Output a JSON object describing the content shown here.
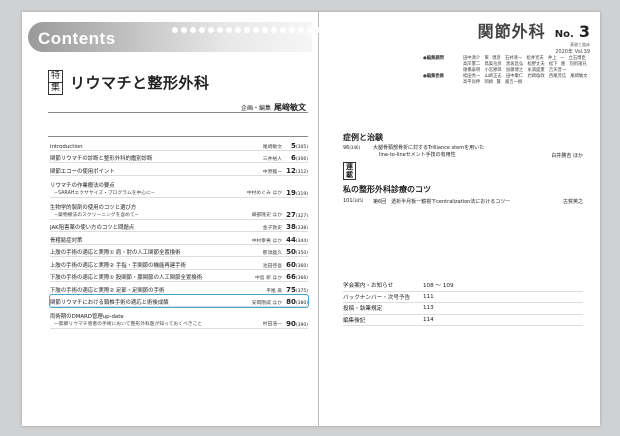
{
  "left_page": {
    "contents_label": "Contents",
    "feature_badge": [
      "特",
      "集"
    ],
    "feature_title": "リウマチと整形外科",
    "editor_role": "企画・編集",
    "editor_name": "尾﨑敏文",
    "toc": [
      {
        "title": "introduction",
        "author": "尾﨑敏文",
        "page": "5",
        "page_sub": "(305)"
      },
      {
        "title": "関節リウマチの診断と整形外科的鑑別診断",
        "author": "三井裕人",
        "page": "6",
        "page_sub": "(306)"
      },
      {
        "title": "関節エコーの使用ポイント",
        "author": "中原龍一",
        "page": "12",
        "page_sub": "(312)"
      },
      {
        "title": "リウマチの作業療法の要点",
        "subtitle": "−SARAHエクササイズ・プログラムを中心に−",
        "author": "中村めぐみ ほか",
        "page": "19",
        "page_sub": "(319)"
      },
      {
        "title": "生物学的製剤の使用のコツと選び方",
        "subtitle": "−薬物療法のスクリーニングを含めて−",
        "author": "織部隆史 ほか",
        "page": "27",
        "page_sub": "(327)"
      },
      {
        "title": "JAK阻害薬の使い方のコツと問題点",
        "author": "金子敦史",
        "page": "38",
        "page_sub": "(338)"
      },
      {
        "title": "骨粗鬆症対策",
        "author": "中村幸男 ほか",
        "page": "44",
        "page_sub": "(344)"
      },
      {
        "title": "上肢の手術の適応と実際① 肩・肘の人工関節全置換術",
        "author": "那須義久",
        "page": "50",
        "page_sub": "(350)"
      },
      {
        "title": "上肢の手術の適応と実際② 手指・手関節の機能再建手術",
        "author": "池田啓吾",
        "page": "60",
        "page_sub": "(360)"
      },
      {
        "title": "下肢の手術の適応と実際① 股関節・膝関節の人工関節全置換術",
        "author": "中島 新 ほか",
        "page": "66",
        "page_sub": "(366)"
      },
      {
        "title": "下肢の手術の適応と実際② 足部・足関節の手術",
        "author": "平尾 眞",
        "page": "75",
        "page_sub": "(375)"
      },
      {
        "title": "関節リウマチにおける頸椎手術の適応と術後成績",
        "author": "安岡剛威 ほか",
        "page": "80",
        "page_sub": "(380)",
        "highlight": true
      },
      {
        "title": "両術期のDMARD管理up-date",
        "subtitle": "—関節リウマチ患者の手術において整形外科医が知っておくべきこと",
        "author": "村田浩一",
        "page": "90",
        "page_sub": "(390)"
      }
    ]
  },
  "right_page": {
    "magazine_title": "関節外科",
    "magazine_subtitle": "基礎と臨床",
    "no_label": "No.",
    "issue_number": "3",
    "year_vol": "2020年 Vol.39",
    "board": [
      {
        "label": "●編集顧問",
        "names": "田中清介　東 博彦　石井清一　松井宣夫　井上 一　立石博臣　高岸憲二　鳥巣岳彦　黒坂昌弘　松野丈夫　松下 隆　別府諸兄　徳橋泰明　小宮節郎　加藤博之　糸満盛憲　吉矢晋一"
      },
      {
        "label": "●編集委員",
        "names": "松田秀一　山崎正志　田中康仁　岩崎倫政　西尾茂信　尾崎敏文　高平尚伸　岡崎 賢　國吉一樹"
      }
    ],
    "sec1_heading": "症例と治験",
    "sec1_entry": {
      "page": "96",
      "page_sub": "(346)",
      "line1": "大腿骨頸部骨折に対するTrilliance stemを用いた",
      "line2": "line-to-lineセメント手技の有用性",
      "author": "白井勝吉 ほか"
    },
    "series_badge": [
      "連",
      "載"
    ],
    "sec2_heading": "私の整形外科診療のコツ",
    "sec2_entry": {
      "page": "101",
      "page_sub": "(345)",
      "title": "第6回　透析半月板ー鏡視下centralization法におけるコツー",
      "author": "古賀英之"
    },
    "misc": [
      {
        "label": "学会案内・お知らせ",
        "pages": "108 〜 109"
      },
      {
        "label": "バックナンバー・次号予告",
        "pages": "111"
      },
      {
        "label": "投稿・執筆規定",
        "pages": "113"
      },
      {
        "label": "編集後記",
        "pages": "114"
      }
    ]
  }
}
